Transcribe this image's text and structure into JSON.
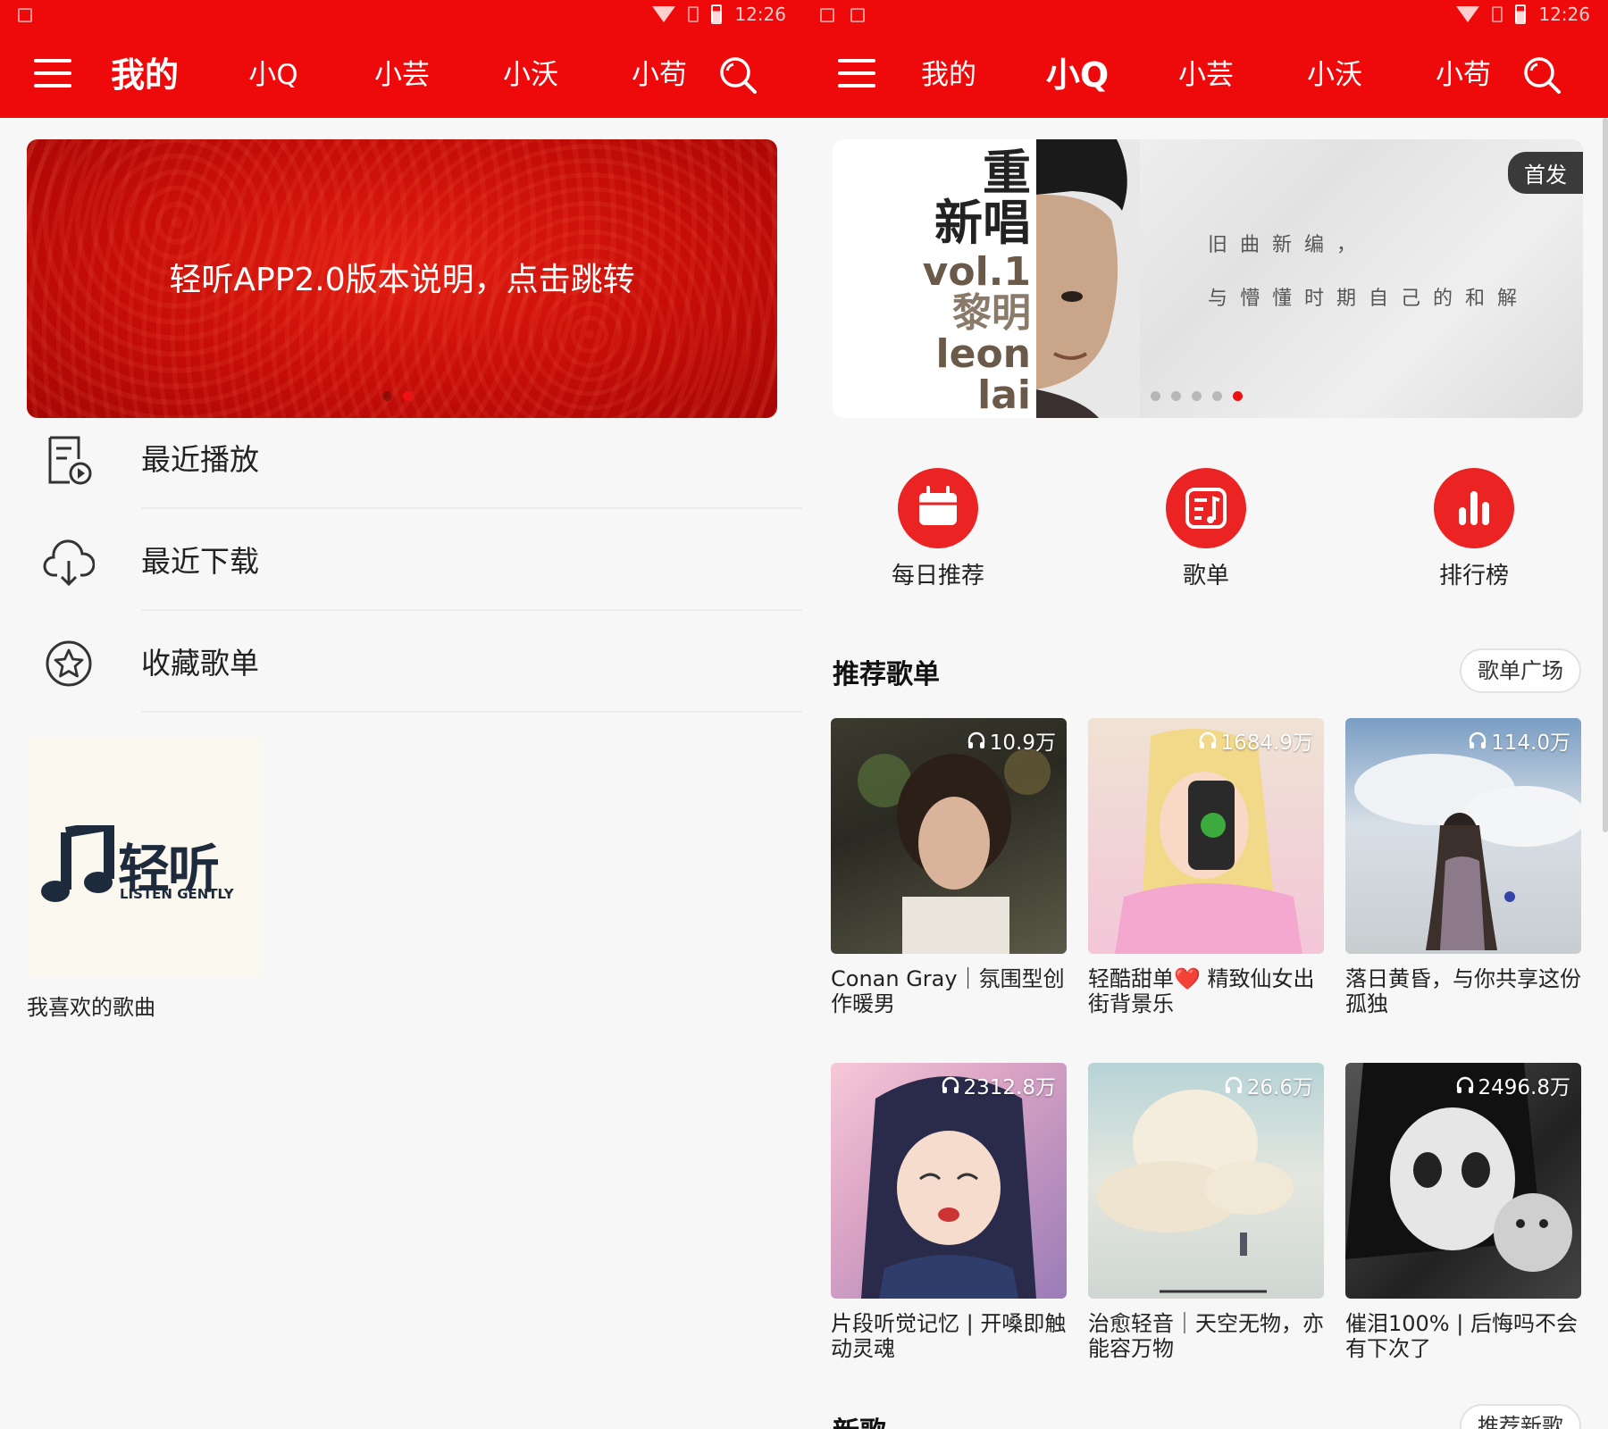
{
  "status": {
    "time": "12:26"
  },
  "tabs_left": [
    "我的",
    "小Q",
    "小芸",
    "小沃",
    "小苟"
  ],
  "tabs_right": [
    "我的",
    "小Q",
    "小芸",
    "小沃",
    "小苟"
  ],
  "left": {
    "banner_text": "轻听APP2.0版本说明，点击跳转",
    "list": [
      {
        "label": "最近播放",
        "icon": "recent-play-icon"
      },
      {
        "label": "最近下载",
        "icon": "cloud-download-icon"
      },
      {
        "label": "收藏歌单",
        "icon": "star-circle-icon"
      }
    ],
    "favorite": {
      "logo_text": "轻听",
      "logo_sub": "LISTEN GENTLY",
      "label": "我喜欢的歌曲"
    }
  },
  "right": {
    "banner": {
      "title_zh_1": "重",
      "title_zh_2": "新唱",
      "title_en_1": "vol.1",
      "title_zh_3": "黎明",
      "title_en_2": "leon",
      "title_en_3": "lai",
      "badge": "首发",
      "line1": "旧曲新编，",
      "line2": "与懵懂时期自己的和解"
    },
    "quick": [
      {
        "label": "每日推荐",
        "icon": "calendar-icon"
      },
      {
        "label": "歌单",
        "icon": "playlist-icon"
      },
      {
        "label": "排行榜",
        "icon": "chart-icon"
      }
    ],
    "recommend_title": "推荐歌单",
    "recommend_more": "歌单广场",
    "playlists": [
      {
        "count": "10.9万",
        "title": "Conan Gray｜氛围型创作暖男"
      },
      {
        "count": "1684.9万",
        "title": "轻酷甜单❤️ 精致仙女出街背景乐"
      },
      {
        "count": "114.0万",
        "title": "落日黄昏，与你共享这份孤独"
      },
      {
        "count": "2312.8万",
        "title": "片段听觉记忆 | 开嗓即触动灵魂"
      },
      {
        "count": "26.6万",
        "title": "治愈轻音｜天空无物，亦能容万物"
      },
      {
        "count": "2496.8万",
        "title": "催泪100% | 后悔吗不会有下次了"
      }
    ],
    "new_title": "新歌",
    "new_more": "推荐新歌"
  },
  "colors": {
    "brand_red": "#ee0a0a",
    "accent_red": "#ec2323"
  }
}
